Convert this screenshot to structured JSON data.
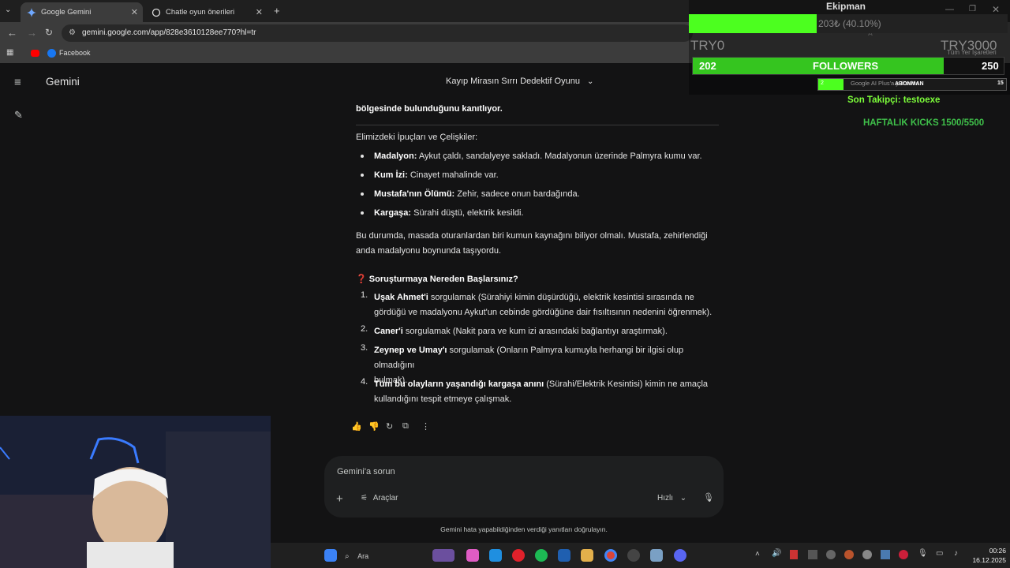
{
  "tabs": [
    {
      "label": "Google Gemini",
      "active": true
    },
    {
      "label": "Chatle oyun önerileri",
      "active": false
    }
  ],
  "url": "gemini.google.com/app/828e3610128ee770?hl=tr",
  "bookmarks": {
    "facebook": "Facebook",
    "all_bookmarks": "Tüm Yer İşaretleri"
  },
  "app": {
    "title": "Gemini",
    "conversation_title": "Kayıp Mirasın Sırrı Dedektif Oyunu"
  },
  "message": {
    "top_line": "bölgesinde bulunduğunu kanıtlıyor.",
    "clues_heading": "Elimizdeki İpuçları ve Çelişkiler:",
    "clues": [
      {
        "bold": "Madalyon:",
        "text": " Aykut çaldı, sandalyeye sakladı. Madalyonun üzerinde Palmyra kumu var."
      },
      {
        "bold": "Kum İzi:",
        "text": " Cinayet mahalinde var."
      },
      {
        "bold": "Mustafa'nın Ölümü:",
        "text": " Zehir, sadece onun bardağında."
      },
      {
        "bold": "Kargaşa:",
        "text": " Sürahi düştü, elektrik kesildi."
      }
    ],
    "paragraph_line1": "Bu durumda, masada oturanlardan biri kumun kaynağını biliyor olmalı. Mustafa, zehirlendiği",
    "paragraph_line2": "anda madalyonu boynunda taşıyordu.",
    "question_icon": "❓",
    "question_heading": "Soruşturmaya Nereden Başlarsınız?",
    "steps": [
      {
        "num": "1.",
        "bold": "Uşak Ahmet'i",
        "line1": " sorgulamak (Sürahiyi kimin düşürdüğü, elektrik kesintisi sırasında ne",
        "line2": "gördüğü ve madalyonu Aykut'un cebinde gördüğüne dair fısıltısının nedenini öğrenmek)."
      },
      {
        "num": "2.",
        "bold": "Caner'i",
        "line1": " sorgulamak (Nakit para ve kum izi arasındaki bağlantıyı araştırmak).",
        "line2": ""
      },
      {
        "num": "3.",
        "bold": "Zeynep ve Umay'ı",
        "line1": " sorgulamak (Onların Palmyra kumuyla herhangi bir ilgisi olup olmadığını",
        "line2": "bulmak)."
      },
      {
        "num": "4.",
        "bold": "Tüm bu olayların yaşandığı kargaşa anını",
        "line1": " (Sürahi/Elektrik Kesintisi) kimin ne amaçla",
        "line2": "kullandığını tespit etmeye çalışmak."
      }
    ]
  },
  "input": {
    "placeholder": "Gemini'a sorun",
    "tools_label": "Araçlar",
    "mode_label": "Hızlı"
  },
  "disclaimer": "Gemini hata yapabildiğinden verdiği yanıtları doğrulayın.",
  "overlay": {
    "equipment_title": "Ekipman",
    "equipment_value": "203₺ (40.10%)",
    "equipment_progress": 0.401,
    "equip_left": "TRY0",
    "equip_right": "TRY3000",
    "followers_current": "202",
    "followers_label": "FOLLOWERS",
    "followers_goal": "250",
    "followers_progress": 0.808,
    "sub_current": "2",
    "sub_label": "ABONMAN",
    "sub_goal": "15",
    "last_follower": "Son Takipçi: testoexe",
    "weekly_kicks": "HAFTALIK KICKS 1500/5500"
  },
  "behind_overlay_text": "Google AI Plus'a yükseltin",
  "taskbar": {
    "search_placeholder": "Ara",
    "time": "00:26",
    "date": "16.12.2025"
  },
  "colors": {
    "accent_green": "#4cff1f",
    "overlay_text_green": "#7dff3a",
    "background": "#131314"
  }
}
